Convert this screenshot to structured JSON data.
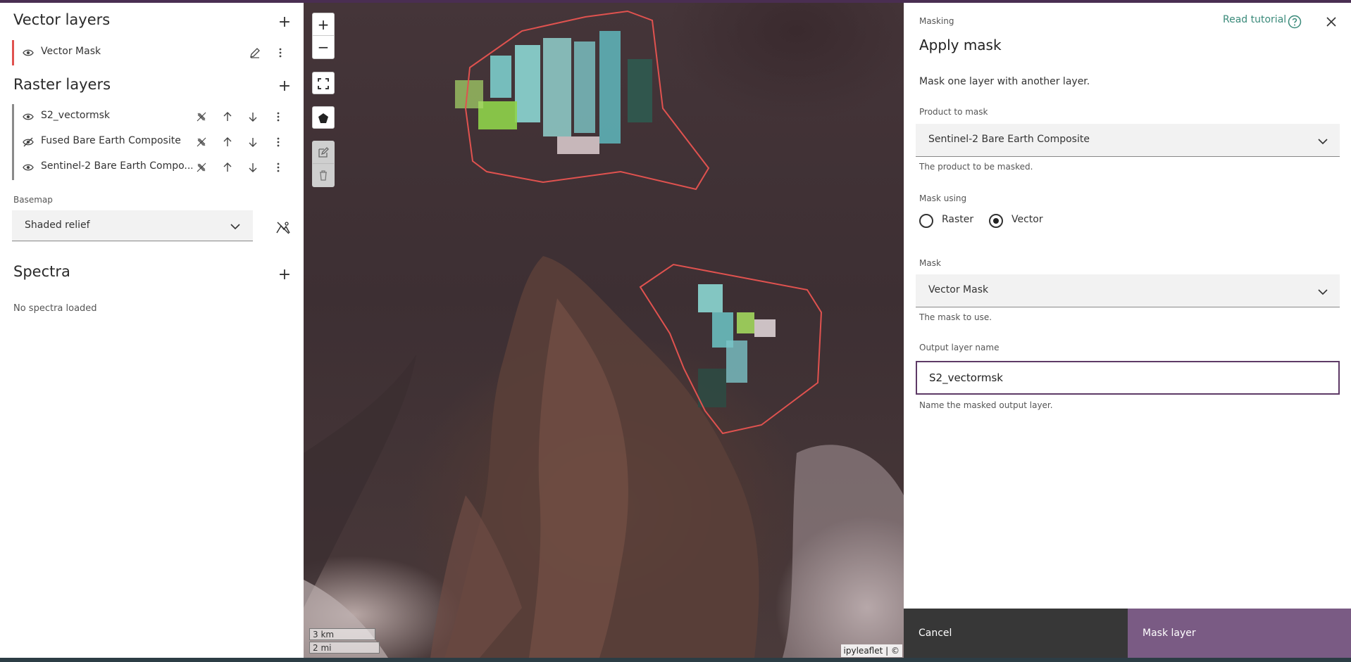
{
  "left_panel": {
    "vector_section": {
      "title": "Vector layers",
      "layers": [
        {
          "name": "Vector Mask",
          "visible": true
        }
      ]
    },
    "raster_section": {
      "title": "Raster layers",
      "layers": [
        {
          "name": "S2_vectormsk",
          "visible": true
        },
        {
          "name": "Fused Bare Earth Composite",
          "visible": false
        },
        {
          "name": "Sentinel-2 Bare Earth Compo...",
          "visible": true
        }
      ]
    },
    "basemap": {
      "label": "Basemap",
      "selected": "Shaded relief"
    },
    "spectra": {
      "title": "Spectra",
      "empty_text": "No spectra loaded"
    }
  },
  "map": {
    "zoom_in": "+",
    "zoom_out": "−",
    "scale_km": "3 km",
    "scale_mi": "2 mi",
    "attribution": "ipyleaflet | ©"
  },
  "right_panel": {
    "breadcrumb": "Masking",
    "tutorial_link": "Read tutorial",
    "title": "Apply mask",
    "description": "Mask one layer with another layer.",
    "product": {
      "label": "Product to mask",
      "selected": "Sentinel-2 Bare Earth Composite",
      "hint": "The product to be masked."
    },
    "mask_using": {
      "label": "Mask using",
      "options": [
        "Raster",
        "Vector"
      ],
      "selected": "Vector"
    },
    "mask": {
      "label": "Mask",
      "selected": "Vector Mask",
      "hint": "The mask to use."
    },
    "output": {
      "label": "Output layer name",
      "value": "S2_vectormsk",
      "hint": "Name the masked output layer."
    },
    "cancel_label": "Cancel",
    "submit_label": "Mask layer"
  },
  "colors": {
    "accent_purple": "#7a5b84",
    "top_bar": "#4a2e52",
    "vector_stripe": "#e0524f",
    "link_teal": "#3a8a7a",
    "mask_outline": "#e0524f"
  }
}
